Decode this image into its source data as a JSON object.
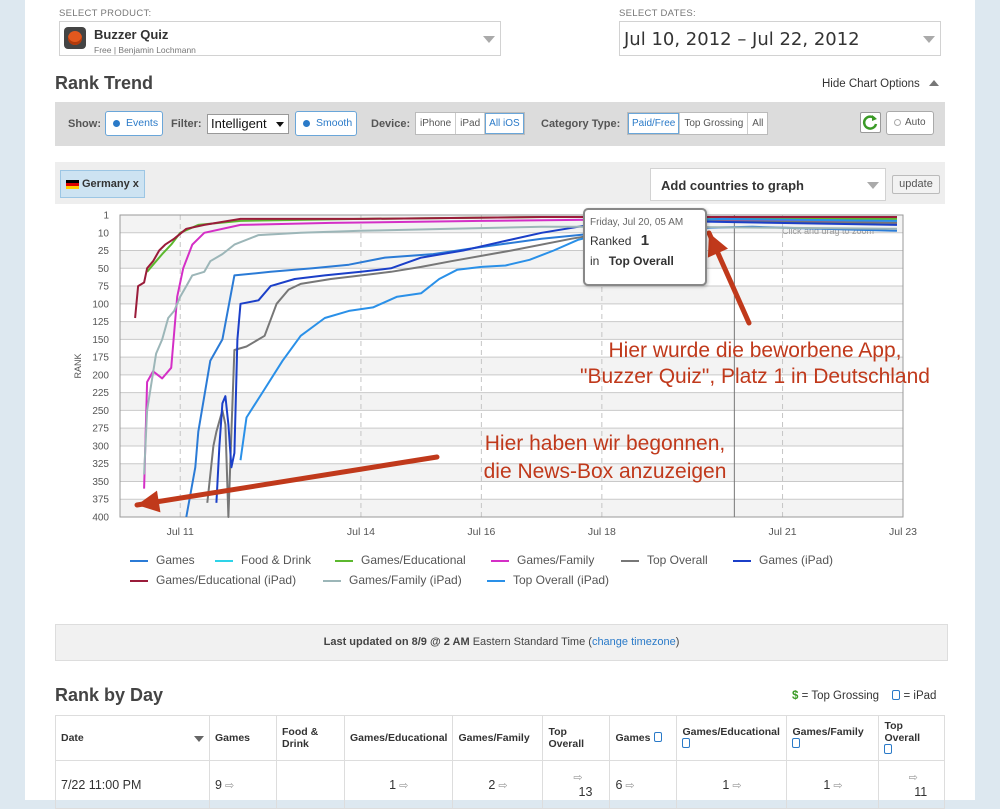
{
  "product": {
    "label": "SELECT PRODUCT:",
    "name": "Buzzer Quiz",
    "sub": "Free | Benjamin Lochmann"
  },
  "dates": {
    "label": "SELECT DATES:",
    "value": "Jul 10, 2012 – Jul 22, 2012"
  },
  "rank_trend": {
    "title": "Rank Trend",
    "hide_options": "Hide Chart Options",
    "show_label": "Show:",
    "events": "Events",
    "filter_label": "Filter:",
    "filter_value": "Intelligent",
    "smooth": "Smooth",
    "device_label": "Device:",
    "devices": [
      "iPhone",
      "iPad",
      "All iOS"
    ],
    "category_label": "Category Type:",
    "categories": [
      "Paid/Free",
      "Top Grossing",
      "All"
    ],
    "auto": "Auto",
    "country_tag": "Germany x",
    "add_countries": "Add countries to graph",
    "update": "update",
    "click_drag": "Click and drag to zoom"
  },
  "tooltip": {
    "date": "Friday, Jul 20, 05 AM",
    "ranked_label": "Ranked",
    "rank": "1",
    "in_label": "in",
    "category": "Top Overall"
  },
  "annotations": {
    "top_line1": "Hier wurde die beworbene App,",
    "top_line2": "\"Buzzer Quiz\", Platz 1 in Deutschland",
    "bottom_line1": "Hier haben wir begonnen,",
    "bottom_line2": "die News-Box anzuzeigen"
  },
  "chart_data": {
    "type": "line",
    "ylabel": "RANK",
    "y_ticks": [
      1,
      10,
      25,
      50,
      75,
      100,
      125,
      150,
      175,
      200,
      225,
      250,
      275,
      300,
      325,
      350,
      375,
      400
    ],
    "y_tick_labels": [
      "1",
      "10",
      "25",
      "50",
      "75",
      "100",
      "125",
      "150",
      "175",
      "200",
      "225",
      "250",
      "275",
      "300",
      "325",
      "350",
      "375",
      "400"
    ],
    "x_ticks": [
      11,
      14,
      16,
      18,
      21,
      23
    ],
    "x_tick_labels": [
      "Jul 11",
      "Jul 14",
      "Jul 16",
      "Jul 18",
      "Jul 21",
      "Jul 23"
    ],
    "x_range": [
      10.0,
      23.0
    ],
    "y_range": [
      1,
      400
    ],
    "series": [
      {
        "name": "Games",
        "color": "#2b7bd6",
        "points": [
          [
            11.1,
            400
          ],
          [
            11.25,
            330
          ],
          [
            11.3,
            280
          ],
          [
            11.5,
            180
          ],
          [
            11.7,
            150
          ],
          [
            11.9,
            60
          ],
          [
            12.5,
            55
          ],
          [
            13.2,
            50
          ],
          [
            13.8,
            45
          ],
          [
            14.4,
            35
          ],
          [
            15.2,
            30
          ],
          [
            16.0,
            22
          ],
          [
            17.0,
            15
          ],
          [
            18.0,
            10
          ],
          [
            19.0,
            8
          ],
          [
            20.5,
            7
          ],
          [
            22.9,
            9
          ]
        ]
      },
      {
        "name": "Food & Drink",
        "color": "#2ed3e8",
        "points": [
          [
            19.2,
            2
          ],
          [
            20.3,
            2
          ],
          [
            21.5,
            3
          ],
          [
            22.9,
            4
          ]
        ]
      },
      {
        "name": "Games/Educational",
        "color": "#5cb82f",
        "points": [
          [
            10.45,
            55
          ],
          [
            10.55,
            45
          ],
          [
            10.7,
            30
          ],
          [
            10.85,
            20
          ],
          [
            11.0,
            10
          ],
          [
            11.3,
            6
          ],
          [
            12.0,
            4
          ],
          [
            14.0,
            3
          ],
          [
            17.0,
            2
          ],
          [
            19.0,
            2
          ],
          [
            22.9,
            3
          ]
        ]
      },
      {
        "name": "Games/Family",
        "color": "#d42fc6",
        "points": [
          [
            10.4,
            360
          ],
          [
            10.45,
            210
          ],
          [
            10.55,
            195
          ],
          [
            10.7,
            205
          ],
          [
            10.85,
            190
          ],
          [
            10.95,
            90
          ],
          [
            11.05,
            50
          ],
          [
            11.2,
            20
          ],
          [
            11.4,
            10
          ],
          [
            12.0,
            6
          ],
          [
            13.5,
            5
          ],
          [
            16.0,
            4
          ],
          [
            19.0,
            3
          ],
          [
            22.9,
            5
          ]
        ]
      },
      {
        "name": "Top Overall",
        "color": "#777777",
        "points": [
          [
            11.45,
            380
          ],
          [
            11.55,
            300
          ],
          [
            11.6,
            280
          ],
          [
            11.7,
            250
          ],
          [
            11.75,
            270
          ],
          [
            11.8,
            400
          ],
          [
            11.85,
            280
          ],
          [
            11.9,
            165
          ],
          [
            12.1,
            160
          ],
          [
            12.4,
            145
          ],
          [
            12.6,
            100
          ],
          [
            12.8,
            80
          ],
          [
            13.0,
            72
          ],
          [
            13.5,
            65
          ],
          [
            14.2,
            58
          ],
          [
            14.5,
            55
          ],
          [
            15.0,
            48
          ],
          [
            15.5,
            40
          ],
          [
            16.5,
            25
          ],
          [
            17.5,
            15
          ],
          [
            18.5,
            8
          ],
          [
            19.5,
            4
          ],
          [
            22.9,
            5
          ]
        ]
      },
      {
        "name": "Games (iPad)",
        "color": "#1b3fc8",
        "points": [
          [
            11.6,
            380
          ],
          [
            11.65,
            300
          ],
          [
            11.7,
            240
          ],
          [
            11.75,
            230
          ],
          [
            11.8,
            270
          ],
          [
            11.85,
            330
          ],
          [
            11.9,
            310
          ],
          [
            11.95,
            150
          ],
          [
            12.0,
            100
          ],
          [
            12.3,
            95
          ],
          [
            12.5,
            75
          ],
          [
            12.9,
            65
          ],
          [
            13.4,
            60
          ],
          [
            14.0,
            55
          ],
          [
            14.5,
            50
          ],
          [
            15.0,
            35
          ],
          [
            15.7,
            25
          ],
          [
            16.3,
            18
          ],
          [
            17.0,
            10
          ],
          [
            18.0,
            5
          ],
          [
            19.0,
            4
          ],
          [
            22.9,
            6
          ]
        ]
      },
      {
        "name": "Games/Educational (iPad)",
        "color": "#9a1c3a",
        "points": [
          [
            10.25,
            120
          ],
          [
            10.3,
            75
          ],
          [
            10.4,
            70
          ],
          [
            10.45,
            50
          ],
          [
            10.55,
            40
          ],
          [
            10.65,
            25
          ],
          [
            10.75,
            20
          ],
          [
            10.9,
            15
          ],
          [
            11.1,
            8
          ],
          [
            11.4,
            6
          ],
          [
            12.0,
            3
          ],
          [
            14.0,
            3
          ],
          [
            17.0,
            2
          ],
          [
            19.0,
            2
          ],
          [
            22.9,
            2
          ]
        ]
      },
      {
        "name": "Games/Family (iPad)",
        "color": "#9cb6b8",
        "points": [
          [
            10.4,
            340
          ],
          [
            10.45,
            250
          ],
          [
            10.6,
            170
          ],
          [
            10.7,
            150
          ],
          [
            10.8,
            120
          ],
          [
            10.9,
            110
          ],
          [
            11.0,
            90
          ],
          [
            11.1,
            75
          ],
          [
            11.2,
            60
          ],
          [
            11.4,
            55
          ],
          [
            11.5,
            40
          ],
          [
            11.7,
            30
          ],
          [
            11.9,
            20
          ],
          [
            12.3,
            12
          ],
          [
            13.0,
            10
          ],
          [
            14.0,
            9
          ],
          [
            15.5,
            8
          ],
          [
            17.0,
            7
          ],
          [
            19.0,
            7
          ],
          [
            22.9,
            8
          ]
        ]
      },
      {
        "name": "Top Overall (iPad)",
        "color": "#2a90e8",
        "points": [
          [
            12.0,
            320
          ],
          [
            12.1,
            260
          ],
          [
            12.4,
            220
          ],
          [
            12.7,
            180
          ],
          [
            13.0,
            145
          ],
          [
            13.4,
            120
          ],
          [
            13.8,
            110
          ],
          [
            14.2,
            105
          ],
          [
            14.6,
            90
          ],
          [
            15.0,
            85
          ],
          [
            15.3,
            65
          ],
          [
            15.6,
            52
          ],
          [
            16.0,
            48
          ],
          [
            16.4,
            46
          ],
          [
            16.8,
            38
          ],
          [
            17.2,
            25
          ],
          [
            17.6,
            16
          ],
          [
            18.0,
            11
          ],
          [
            18.5,
            6
          ],
          [
            19.0,
            4
          ],
          [
            20.0,
            3
          ],
          [
            22.9,
            4
          ]
        ]
      }
    ]
  },
  "legend": [
    {
      "name": "Games",
      "color": "#2b7bd6"
    },
    {
      "name": "Food & Drink",
      "color": "#2ed3e8"
    },
    {
      "name": "Games/Educational",
      "color": "#5cb82f"
    },
    {
      "name": "Games/Family",
      "color": "#d42fc6"
    },
    {
      "name": "Top Overall",
      "color": "#777777"
    },
    {
      "name": "Games (iPad)",
      "color": "#1b3fc8"
    },
    {
      "name": "Games/Educational (iPad)",
      "color": "#9a1c3a"
    },
    {
      "name": "Games/Family (iPad)",
      "color": "#9cb6b8"
    },
    {
      "name": "Top Overall (iPad)",
      "color": "#2a90e8"
    }
  ],
  "last_updated": {
    "prefix": "Last updated on 8/9 @ 2 AM",
    "tz": "Eastern Standard Time",
    "link": "change timezone"
  },
  "rank_by_day": {
    "title": "Rank by Day",
    "legend_grossing_symbol": "$",
    "legend_grossing": "= Top Grossing",
    "legend_ipad": "= iPad",
    "headers": [
      "Date",
      "Games",
      "Food & Drink",
      "Games/Educational",
      "Games/Family",
      "Top Overall",
      "Games",
      "Games/Educational",
      "Games/Family",
      "Top Overall"
    ],
    "rows": [
      [
        "7/22 11:00 PM",
        "9",
        "",
        "1",
        "2",
        "13",
        "6",
        "1",
        "1",
        "11"
      ]
    ]
  }
}
